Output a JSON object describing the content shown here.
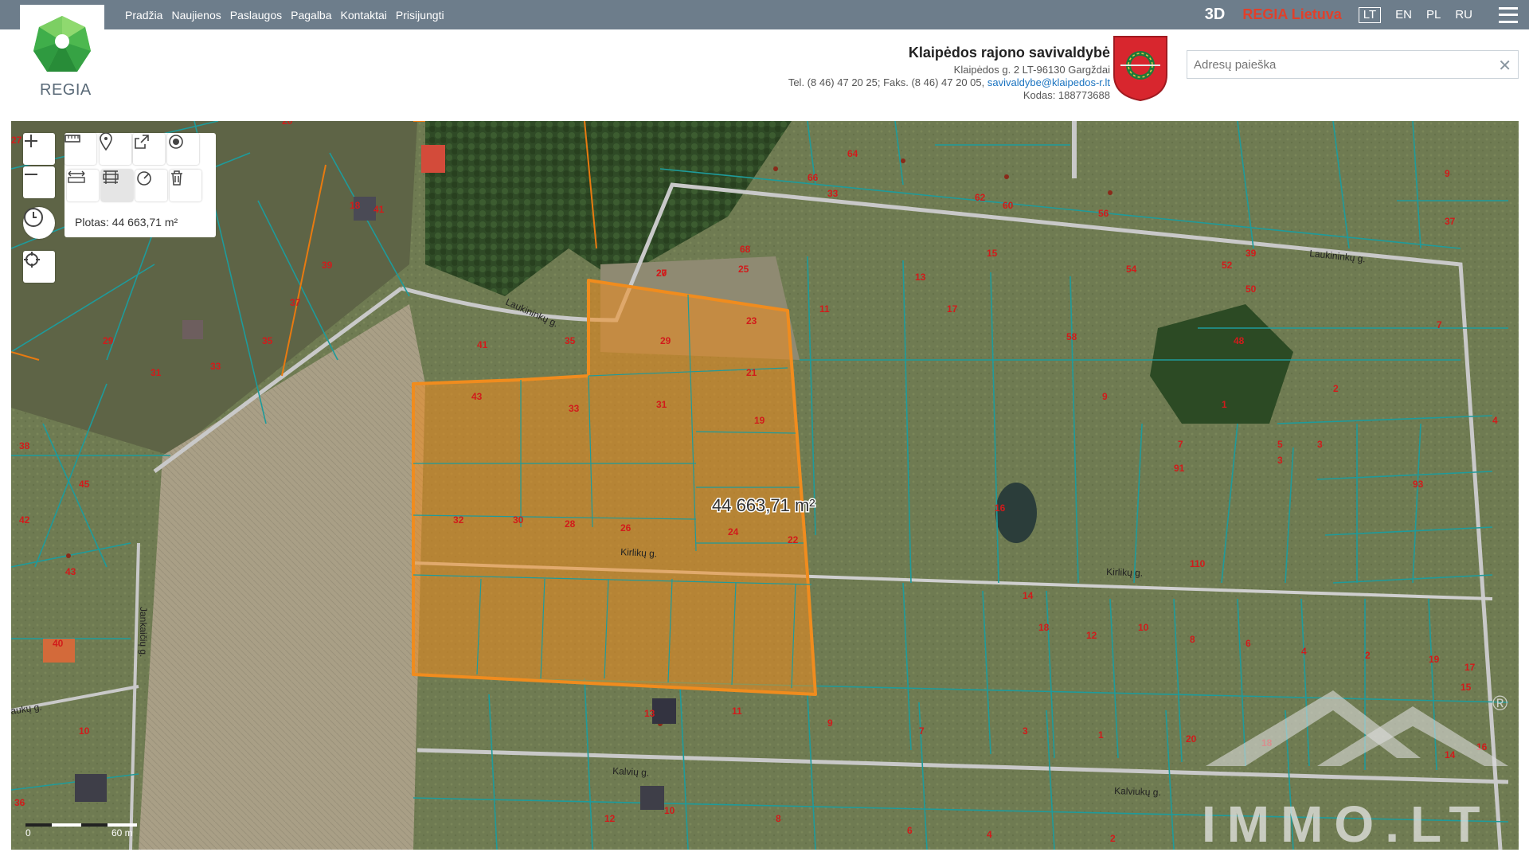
{
  "nav": [
    "Pradžia",
    "Naujienos",
    "Paslaugos",
    "Pagalba",
    "Kontaktai",
    "Prisijungti"
  ],
  "right": {
    "btn3d": "3D",
    "regia_lietuva": "REGIA Lietuva",
    "langs": [
      "LT",
      "EN",
      "PL",
      "RU"
    ],
    "active_lang": "LT"
  },
  "logo": {
    "text": "REGIA"
  },
  "municipality": {
    "name": "Klaipėdos rajono savivaldybė",
    "address": "Klaipėdos g. 2 LT-96130 Gargždai",
    "phone": "Tel. (8 46) 47 20 25; Faks. (8 46) 47 20 05,",
    "email": "savivaldybe@klaipedos-r.lt",
    "code": "Kodas: 188773688"
  },
  "search": {
    "placeholder": "Adresų paieška",
    "value": ""
  },
  "map": {
    "measure_label": "Plotas: 44 663,71 m²",
    "area_label": "44 663,71 m²",
    "streets": [
      "Laukininkų g.",
      "Laukininkų g.",
      "Kirlikų g.",
      "Kirlikų g.",
      "Kalvių g.",
      "Kalviukų g.",
      "Jankaičių g.",
      "aukų g."
    ],
    "scale_labels": [
      "0",
      "60 m"
    ],
    "watermark": "IMMO.LT",
    "watermark_mark": "®",
    "parcels_selected": [
      "27",
      "25",
      "23",
      "21",
      "19",
      "29",
      "31",
      "33",
      "35",
      "41",
      "43",
      "32",
      "30",
      "28",
      "26",
      "24",
      "22",
      "20"
    ],
    "parcels_other": [
      "20",
      "18",
      "41",
      "39",
      "37",
      "35",
      "33",
      "31",
      "29",
      "27",
      "38",
      "45",
      "42",
      "43",
      "40",
      "10",
      "36",
      "33",
      "68",
      "66",
      "64",
      "62",
      "60",
      "58",
      "56",
      "54",
      "52",
      "50",
      "48",
      "15",
      "13",
      "17",
      "11",
      "9",
      "7",
      "5",
      "3",
      "4",
      "2",
      "1",
      "3",
      "91",
      "93",
      "110",
      "9",
      "7",
      "39",
      "37",
      "18",
      "16",
      "14",
      "12",
      "10",
      "8",
      "6",
      "4",
      "2",
      "19",
      "17",
      "15",
      "13",
      "11",
      "9",
      "7",
      "3",
      "1",
      "20",
      "18",
      "16",
      "14",
      "12",
      "10",
      "8",
      "6",
      "4",
      "2"
    ]
  },
  "colors": {
    "topbar": "#6d7d8b",
    "selection": "#f08c1e",
    "parcel_line": "#1e9b9b",
    "label": "#d11b1b"
  }
}
